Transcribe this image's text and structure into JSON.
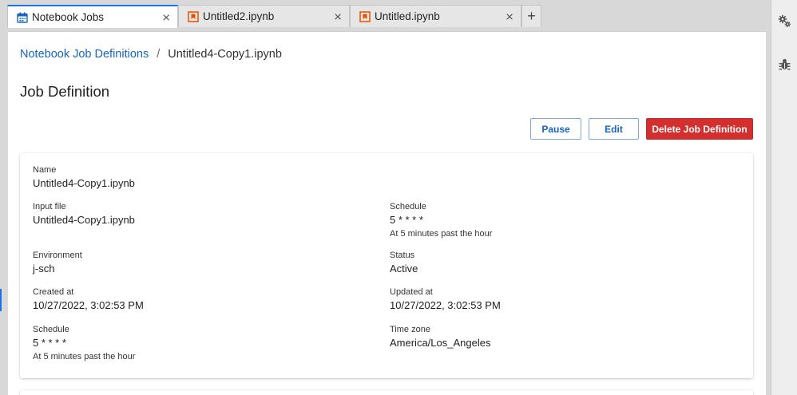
{
  "tabs": [
    {
      "label": "Notebook Jobs",
      "icon": "calendar-icon",
      "active": true
    },
    {
      "label": "Untitled2.ipynb",
      "icon": "notebook-icon",
      "active": false
    },
    {
      "label": "Untitled.ipynb",
      "icon": "notebook-icon",
      "active": false
    }
  ],
  "tab_close_glyph": "×",
  "tab_add_glyph": "+",
  "breadcrumb": {
    "link": "Notebook Job Definitions",
    "separator": "/",
    "current": "Untitled4-Copy1.ipynb"
  },
  "page_title": "Job Definition",
  "actions": {
    "pause": "Pause",
    "edit": "Edit",
    "delete": "Delete Job Definition"
  },
  "details": {
    "name": {
      "label": "Name",
      "value": "Untitled4-Copy1.ipynb"
    },
    "input_file": {
      "label": "Input file",
      "value": "Untitled4-Copy1.ipynb"
    },
    "schedule_right": {
      "label": "Schedule",
      "value": "5 * * * *",
      "sub": "At 5 minutes past the hour"
    },
    "environment": {
      "label": "Environment",
      "value": "j-sch"
    },
    "status": {
      "label": "Status",
      "value": "Active"
    },
    "created_at": {
      "label": "Created at",
      "value": "10/27/2022, 3:02:53 PM"
    },
    "updated_at": {
      "label": "Updated at",
      "value": "10/27/2022, 3:02:53 PM"
    },
    "schedule_left": {
      "label": "Schedule",
      "value": "5 * * * *",
      "sub": "At 5 minutes past the hour"
    },
    "time_zone": {
      "label": "Time zone",
      "value": "America/Los_Angeles"
    }
  },
  "right_sidebar": [
    "gears-icon",
    "bug-icon"
  ],
  "colors": {
    "accent": "#1a73e8",
    "link": "#1565c0",
    "danger": "#d32f2f",
    "notebook_icon": "#e65100"
  }
}
